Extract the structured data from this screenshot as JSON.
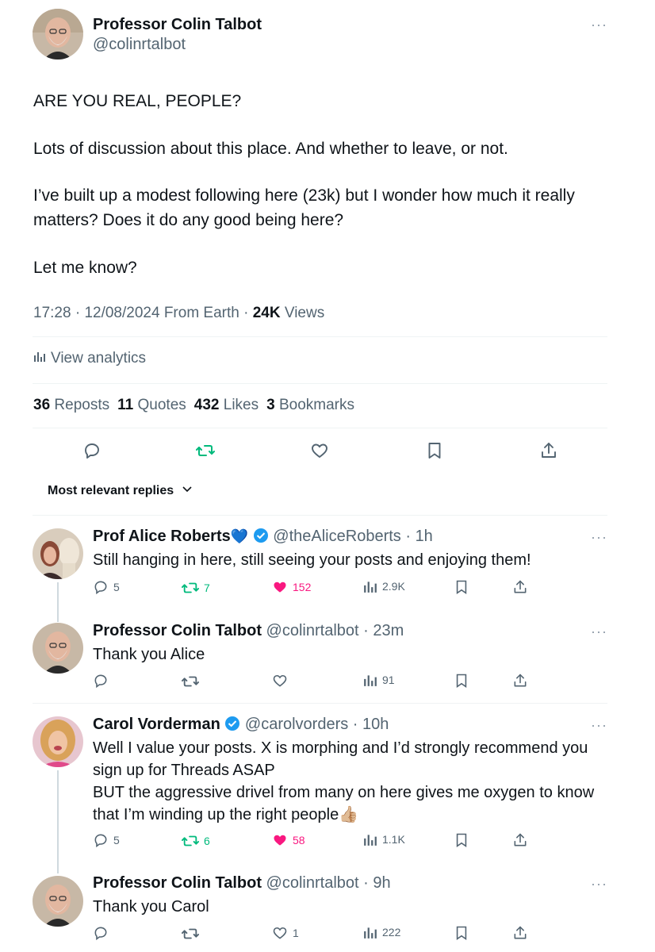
{
  "tweet": {
    "author_name": "Professor Colin Talbot",
    "author_handle": "@colinrtalbot",
    "more_label": "···",
    "paragraphs": [
      "ARE YOU REAL, PEOPLE?",
      "Lots of discussion about this place. And whether to leave, or not.",
      "I’ve built up a modest following here (23k) but I wonder how much it really matters? Does it do any good being here?",
      "Let me know?"
    ],
    "time": "17:28",
    "date": "12/08/2024",
    "source": "From Earth",
    "views_count": "24K",
    "views_label": "Views",
    "analytics_label": "View analytics",
    "stats": {
      "reposts_count": "36",
      "reposts_label": "Reposts",
      "quotes_count": "11",
      "quotes_label": "Quotes",
      "likes_count": "432",
      "likes_label": "Likes",
      "bookmarks_count": "3",
      "bookmarks_label": "Bookmarks"
    }
  },
  "replies_filter": {
    "label": "Most relevant replies"
  },
  "replies": [
    {
      "name": "Prof Alice Roberts",
      "emoji": "💙",
      "verified": true,
      "handle": "@theAliceRoberts",
      "time": "1h",
      "text": "Still hanging in here, still seeing your posts and enjoying them!",
      "replies": "5",
      "reposts": "7",
      "likes": "152",
      "views": "2.9K",
      "liked": true,
      "reposted": true
    },
    {
      "name": "Professor Colin Talbot",
      "verified": false,
      "handle": "@colinrtalbot",
      "time": "23m",
      "text": "Thank you Alice",
      "replies": "",
      "reposts": "",
      "likes": "",
      "views": "91",
      "liked": false,
      "reposted": false
    },
    {
      "name": "Carol Vorderman",
      "verified": true,
      "handle": "@carolvorders",
      "time": "10h",
      "text_lines": [
        "Well I value your posts.  X is morphing and I’d strongly recommend you",
        "sign up for Threads ASAP",
        "BUT the aggressive drivel from many on here gives me oxygen to know",
        "that I’m winding up the right people👍🏼"
      ],
      "replies": "5",
      "reposts": "6",
      "likes": "58",
      "views": "1.1K",
      "liked": true,
      "reposted": true
    },
    {
      "name": "Professor Colin Talbot",
      "verified": false,
      "handle": "@colinrtalbot",
      "time": "9h",
      "text": "Thank you Carol",
      "replies": "",
      "reposts": "",
      "likes": "1",
      "views": "222",
      "liked": false,
      "reposted": false
    }
  ],
  "colors": {
    "text": "#0f1419",
    "muted": "#536471",
    "accent_blue": "#1d9bf0",
    "repost_green": "#00ba7c",
    "like_pink": "#f91880",
    "border": "#eff3f4"
  },
  "icons": [
    "reply-icon",
    "repost-icon",
    "like-icon",
    "bookmark-icon",
    "share-icon",
    "analytics-icon",
    "verified-icon",
    "chevron-down-icon"
  ]
}
